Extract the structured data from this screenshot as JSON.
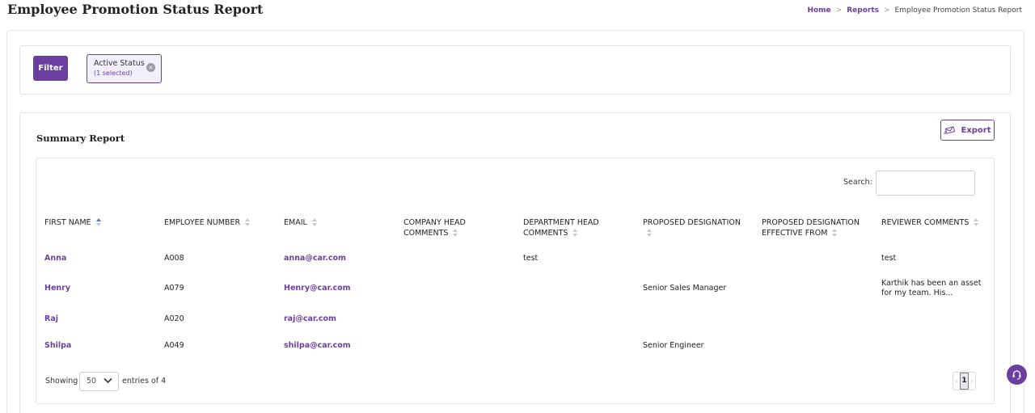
{
  "header": {
    "title": "Employee Promotion Status Report",
    "breadcrumb": {
      "home": "Home",
      "reports": "Reports",
      "current": "Employee Promotion Status Report",
      "separator": ">"
    }
  },
  "filter": {
    "button_label": "Filter",
    "chip": {
      "title": "Active Status",
      "subtitle": "(1 selected)"
    }
  },
  "summary": {
    "title": "Summary Report",
    "export_label": "Export",
    "search_label": "Search:",
    "search_value": "",
    "columns": [
      {
        "line1": "FIRST NAME",
        "line2": ""
      },
      {
        "line1": "EMPLOYEE NUMBER",
        "line2": ""
      },
      {
        "line1": "EMAIL",
        "line2": ""
      },
      {
        "line1": "COMPANY HEAD",
        "line2": "COMMENTS"
      },
      {
        "line1": "DEPARTMENT HEAD",
        "line2": "COMMENTS"
      },
      {
        "line1": "PROPOSED DESIGNATION",
        "line2": ""
      },
      {
        "line1": "PROPOSED DESIGNATION",
        "line2": "EFFECTIVE FROM"
      },
      {
        "line1": "REVIEWER COMMENTS",
        "line2": ""
      }
    ],
    "rows": [
      {
        "first_name": "Anna",
        "employee_number": "A008",
        "email": "anna@car.com",
        "company_head_comments": "",
        "department_head_comments": "test",
        "proposed_designation": "",
        "effective_from": "",
        "reviewer_comments_1": "test",
        "reviewer_comments_2": ""
      },
      {
        "first_name": "Henry",
        "employee_number": "A079",
        "email": "Henry@car.com",
        "company_head_comments": "",
        "department_head_comments": "",
        "proposed_designation": "Senior Sales Manager",
        "effective_from": "",
        "reviewer_comments_1": "Karthik has been an asset",
        "reviewer_comments_2": "for my team. His..."
      },
      {
        "first_name": "Raj",
        "employee_number": "A020",
        "email": "raj@car.com",
        "company_head_comments": "",
        "department_head_comments": "",
        "proposed_designation": "",
        "effective_from": "",
        "reviewer_comments_1": "",
        "reviewer_comments_2": ""
      },
      {
        "first_name": "Shilpa",
        "employee_number": "A049",
        "email": "shilpa@car.com",
        "company_head_comments": "",
        "department_head_comments": "",
        "proposed_designation": "Senior Engineer",
        "effective_from": "",
        "reviewer_comments_1": "",
        "reviewer_comments_2": ""
      }
    ],
    "footer": {
      "showing": "Showing",
      "page_size": "50",
      "entries_of": "entries of 4",
      "current_page": "1",
      "prev": "‹",
      "next": "›"
    }
  },
  "icons": {
    "sort": "sort-icon",
    "export": "export-icon",
    "close": "close-icon",
    "chevron": "chevron-down-icon",
    "help": "headset-icon"
  },
  "colors": {
    "accent": "#6b3fa0",
    "sort_active": "#3b7dd8"
  }
}
